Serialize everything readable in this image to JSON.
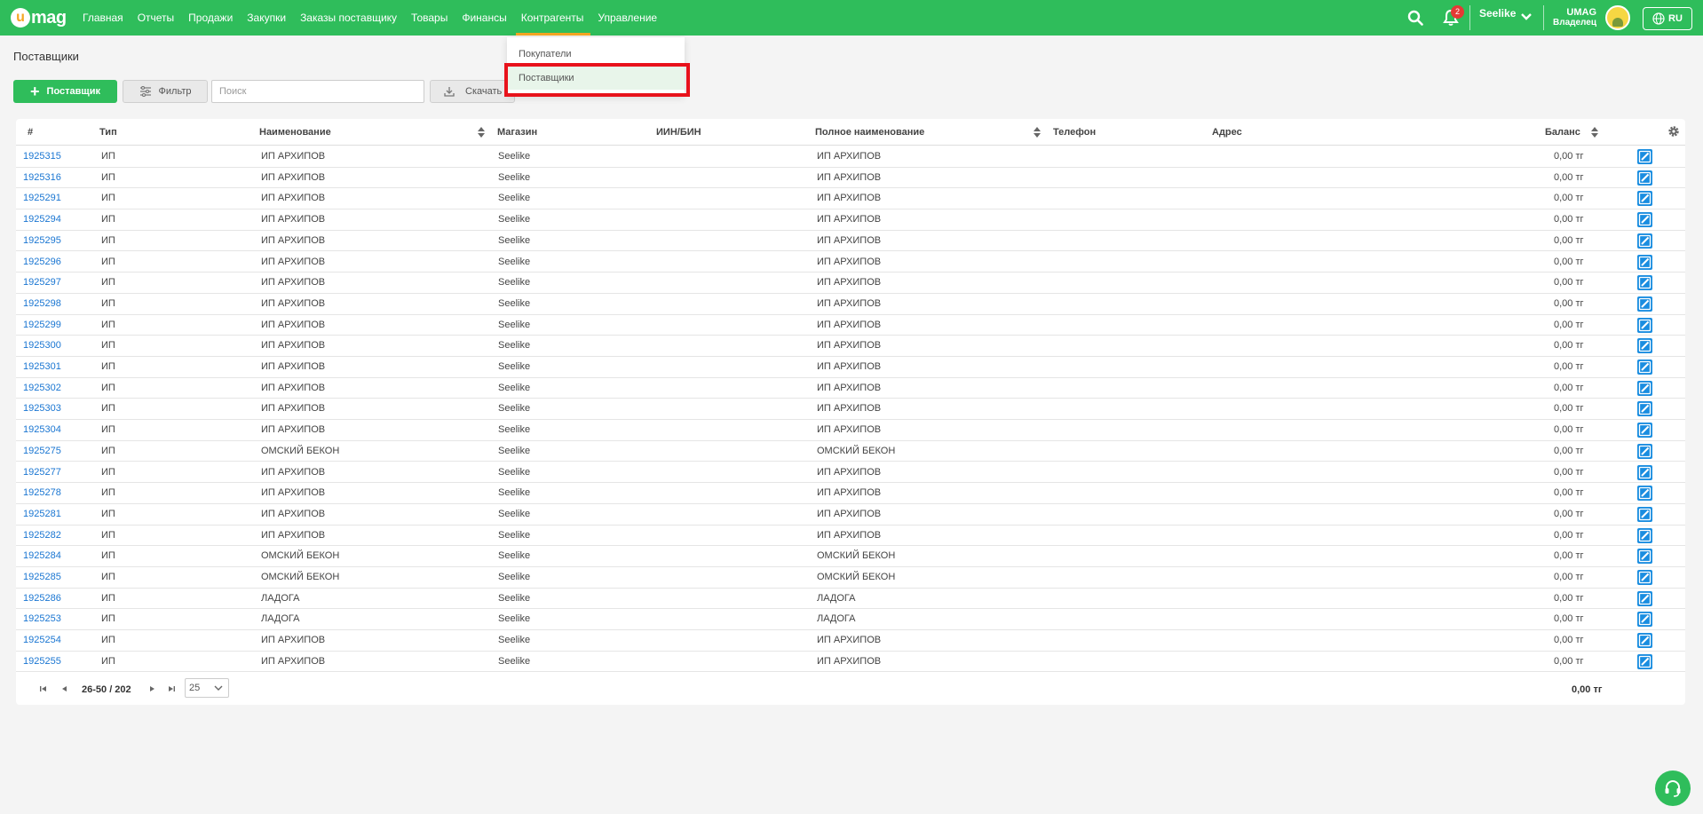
{
  "brand": {
    "logo_text": "mag",
    "logo_letter": "u"
  },
  "nav": {
    "items": [
      "Главная",
      "Отчеты",
      "Продажи",
      "Закупки",
      "Заказы поставщику",
      "Товары",
      "Финансы",
      "Контрагенты",
      "Управление"
    ],
    "active": "Контрагенты"
  },
  "header": {
    "notifications_count": "2",
    "store": "Seelike",
    "user_name": "UMAG",
    "user_role": "Владелец",
    "lang": "RU"
  },
  "dropdown": {
    "items": [
      "Покупатели",
      "Поставщики"
    ],
    "selected": "Поставщики"
  },
  "page": {
    "title": "Поставщики"
  },
  "toolbar": {
    "add_label": "Поставщик",
    "filter_label": "Фильтр",
    "search_placeholder": "Поиск",
    "download_label": "Скачать"
  },
  "table": {
    "headers": {
      "id": "#",
      "type": "Тип",
      "name": "Наименование",
      "store": "Магазин",
      "iin": "ИИН/БИН",
      "full_name": "Полное наименование",
      "phone": "Телефон",
      "address": "Адрес",
      "balance": "Баланс"
    },
    "rows": [
      {
        "id": "1925315",
        "type": "ИП",
        "name": "ИП АРХИПОВ",
        "store": "Seelike",
        "full_name": "ИП АРХИПОВ",
        "balance": "0,00 тг"
      },
      {
        "id": "1925316",
        "type": "ИП",
        "name": "ИП АРХИПОВ",
        "store": "Seelike",
        "full_name": "ИП АРХИПОВ",
        "balance": "0,00 тг"
      },
      {
        "id": "1925291",
        "type": "ИП",
        "name": "ИП АРХИПОВ",
        "store": "Seelike",
        "full_name": "ИП АРХИПОВ",
        "balance": "0,00 тг"
      },
      {
        "id": "1925294",
        "type": "ИП",
        "name": "ИП АРХИПОВ",
        "store": "Seelike",
        "full_name": "ИП АРХИПОВ",
        "balance": "0,00 тг"
      },
      {
        "id": "1925295",
        "type": "ИП",
        "name": "ИП АРХИПОВ",
        "store": "Seelike",
        "full_name": "ИП АРХИПОВ",
        "balance": "0,00 тг"
      },
      {
        "id": "1925296",
        "type": "ИП",
        "name": "ИП АРХИПОВ",
        "store": "Seelike",
        "full_name": "ИП АРХИПОВ",
        "balance": "0,00 тг"
      },
      {
        "id": "1925297",
        "type": "ИП",
        "name": "ИП АРХИПОВ",
        "store": "Seelike",
        "full_name": "ИП АРХИПОВ",
        "balance": "0,00 тг"
      },
      {
        "id": "1925298",
        "type": "ИП",
        "name": "ИП АРХИПОВ",
        "store": "Seelike",
        "full_name": "ИП АРХИПОВ",
        "balance": "0,00 тг"
      },
      {
        "id": "1925299",
        "type": "ИП",
        "name": "ИП АРХИПОВ",
        "store": "Seelike",
        "full_name": "ИП АРХИПОВ",
        "balance": "0,00 тг"
      },
      {
        "id": "1925300",
        "type": "ИП",
        "name": "ИП АРХИПОВ",
        "store": "Seelike",
        "full_name": "ИП АРХИПОВ",
        "balance": "0,00 тг"
      },
      {
        "id": "1925301",
        "type": "ИП",
        "name": "ИП АРХИПОВ",
        "store": "Seelike",
        "full_name": "ИП АРХИПОВ",
        "balance": "0,00 тг"
      },
      {
        "id": "1925302",
        "type": "ИП",
        "name": "ИП АРХИПОВ",
        "store": "Seelike",
        "full_name": "ИП АРХИПОВ",
        "balance": "0,00 тг"
      },
      {
        "id": "1925303",
        "type": "ИП",
        "name": "ИП АРХИПОВ",
        "store": "Seelike",
        "full_name": "ИП АРХИПОВ",
        "balance": "0,00 тг"
      },
      {
        "id": "1925304",
        "type": "ИП",
        "name": "ИП АРХИПОВ",
        "store": "Seelike",
        "full_name": "ИП АРХИПОВ",
        "balance": "0,00 тг"
      },
      {
        "id": "1925275",
        "type": "ИП",
        "name": "ОМСКИЙ БЕКОН",
        "store": "Seelike",
        "full_name": "ОМСКИЙ БЕКОН",
        "balance": "0,00 тг"
      },
      {
        "id": "1925277",
        "type": "ИП",
        "name": "ИП АРХИПОВ",
        "store": "Seelike",
        "full_name": "ИП АРХИПОВ",
        "balance": "0,00 тг"
      },
      {
        "id": "1925278",
        "type": "ИП",
        "name": "ИП АРХИПОВ",
        "store": "Seelike",
        "full_name": "ИП АРХИПОВ",
        "balance": "0,00 тг"
      },
      {
        "id": "1925281",
        "type": "ИП",
        "name": "ИП АРХИПОВ",
        "store": "Seelike",
        "full_name": "ИП АРХИПОВ",
        "balance": "0,00 тг"
      },
      {
        "id": "1925282",
        "type": "ИП",
        "name": "ИП АРХИПОВ",
        "store": "Seelike",
        "full_name": "ИП АРХИПОВ",
        "balance": "0,00 тг"
      },
      {
        "id": "1925284",
        "type": "ИП",
        "name": "ОМСКИЙ БЕКОН",
        "store": "Seelike",
        "full_name": "ОМСКИЙ БЕКОН",
        "balance": "0,00 тг"
      },
      {
        "id": "1925285",
        "type": "ИП",
        "name": "ОМСКИЙ БЕКОН",
        "store": "Seelike",
        "full_name": "ОМСКИЙ БЕКОН",
        "balance": "0,00 тг"
      },
      {
        "id": "1925286",
        "type": "ИП",
        "name": "ЛАДОГА",
        "store": "Seelike",
        "full_name": "ЛАДОГА",
        "balance": "0,00 тг"
      },
      {
        "id": "1925253",
        "type": "ИП",
        "name": "ЛАДОГА",
        "store": "Seelike",
        "full_name": "ЛАДОГА",
        "balance": "0,00 тг"
      },
      {
        "id": "1925254",
        "type": "ИП",
        "name": "ИП АРХИПОВ",
        "store": "Seelike",
        "full_name": "ИП АРХИПОВ",
        "balance": "0,00 тг"
      },
      {
        "id": "1925255",
        "type": "ИП",
        "name": "ИП АРХИПОВ",
        "store": "Seelike",
        "full_name": "ИП АРХИПОВ",
        "balance": "0,00 тг"
      }
    ]
  },
  "pagination": {
    "range": "26-50 / 202",
    "page_size": "25"
  },
  "totals": {
    "balance": "0,00 тг"
  },
  "colors": {
    "brand_green": "#2fbd5b",
    "accent_orange": "#f5a623",
    "link_blue": "#1a76d2",
    "highlight_red": "#e8121b"
  },
  "icons": [
    "search-icon",
    "bell-icon",
    "chevron-down-icon",
    "globe-icon",
    "plus-icon",
    "filter-icon",
    "download-icon",
    "sort-icon",
    "gear-icon",
    "edit-icon",
    "first-page-icon",
    "prev-page-icon",
    "next-page-icon",
    "last-page-icon",
    "headset-icon"
  ]
}
